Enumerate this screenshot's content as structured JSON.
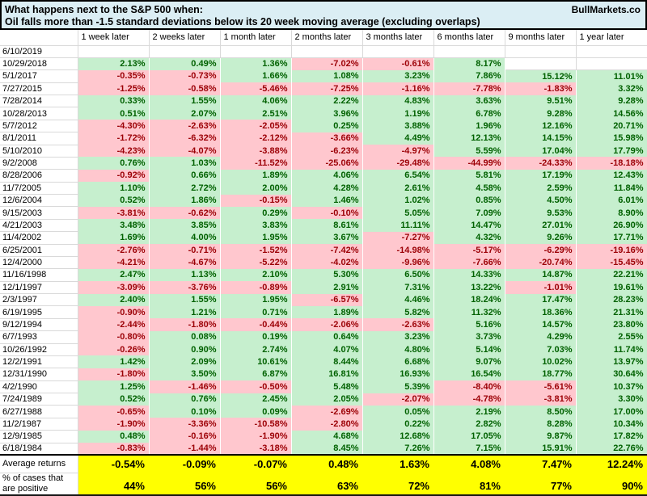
{
  "title": {
    "line1": "What happens next to the S&P 500 when:",
    "line2": "Oil falls more than -1.5 standard deviations below its 20 week moving average (excluding overlaps)",
    "brand": "BullMarkets.co"
  },
  "colors": {
    "title_bg": "#dbeef4",
    "positive_bg": "#c6efce",
    "positive_text": "#006100",
    "negative_bg": "#ffc7ce",
    "negative_text": "#9c0006",
    "highlight_bg": "#ffff00"
  },
  "chart_data": {
    "type": "table",
    "title": "What happens next to the S&P 500 when: Oil falls more than -1.5 standard deviations below its 20 week moving average (excluding overlaps)",
    "columns": [
      "1 week later",
      "2 weeks later",
      "1 month later",
      "2 months later",
      "3 months later",
      "6 months later",
      "9 months later",
      "1 year later"
    ],
    "rows": [
      {
        "date": "6/10/2019",
        "values": [
          null,
          null,
          null,
          null,
          null,
          null,
          null,
          null
        ]
      },
      {
        "date": "10/29/2018",
        "values": [
          "2.13%",
          "0.49%",
          "1.36%",
          "-7.02%",
          "-0.61%",
          "8.17%",
          null,
          null
        ]
      },
      {
        "date": "5/1/2017",
        "values": [
          "-0.35%",
          "-0.73%",
          "1.66%",
          "1.08%",
          "3.23%",
          "7.86%",
          "15.12%",
          "11.01%"
        ]
      },
      {
        "date": "7/27/2015",
        "values": [
          "-1.25%",
          "-0.58%",
          "-5.46%",
          "-7.25%",
          "-1.16%",
          "-7.78%",
          "-1.83%",
          "3.32%"
        ]
      },
      {
        "date": "7/28/2014",
        "values": [
          "0.33%",
          "1.55%",
          "4.06%",
          "2.22%",
          "4.83%",
          "3.63%",
          "9.51%",
          "9.28%"
        ]
      },
      {
        "date": "10/28/2013",
        "values": [
          "0.51%",
          "2.07%",
          "2.51%",
          "3.96%",
          "1.19%",
          "6.78%",
          "9.28%",
          "14.56%"
        ]
      },
      {
        "date": "5/7/2012",
        "values": [
          "-4.30%",
          "-2.63%",
          "-2.05%",
          "0.25%",
          "3.88%",
          "1.96%",
          "12.16%",
          "20.71%"
        ]
      },
      {
        "date": "8/1/2011",
        "values": [
          "-1.72%",
          "-6.32%",
          "-2.12%",
          "-3.66%",
          "4.49%",
          "12.13%",
          "14.15%",
          "15.98%"
        ]
      },
      {
        "date": "5/10/2010",
        "values": [
          "-4.23%",
          "-4.07%",
          "-3.88%",
          "-6.23%",
          "-4.97%",
          "5.59%",
          "17.04%",
          "17.79%"
        ]
      },
      {
        "date": "9/2/2008",
        "values": [
          "0.76%",
          "1.03%",
          "-11.52%",
          "-25.06%",
          "-29.48%",
          "-44.99%",
          "-24.33%",
          "-18.18%"
        ]
      },
      {
        "date": "8/28/2006",
        "values": [
          "-0.92%",
          "0.66%",
          "1.89%",
          "4.06%",
          "6.54%",
          "5.81%",
          "17.19%",
          "12.43%"
        ]
      },
      {
        "date": "11/7/2005",
        "values": [
          "1.10%",
          "2.72%",
          "2.00%",
          "4.28%",
          "2.61%",
          "4.58%",
          "2.59%",
          "11.84%"
        ]
      },
      {
        "date": "12/6/2004",
        "values": [
          "0.52%",
          "1.86%",
          "-0.15%",
          "1.46%",
          "1.02%",
          "0.85%",
          "4.50%",
          "6.01%"
        ]
      },
      {
        "date": "9/15/2003",
        "values": [
          "-3.81%",
          "-0.62%",
          "0.29%",
          "-0.10%",
          "5.05%",
          "7.09%",
          "9.53%",
          "8.90%"
        ]
      },
      {
        "date": "4/21/2003",
        "values": [
          "3.48%",
          "3.85%",
          "3.83%",
          "8.61%",
          "11.11%",
          "14.47%",
          "27.01%",
          "26.90%"
        ]
      },
      {
        "date": "11/4/2002",
        "values": [
          "1.69%",
          "4.00%",
          "1.95%",
          "3.67%",
          "-7.27%",
          "4.32%",
          "9.26%",
          "17.71%"
        ]
      },
      {
        "date": "6/25/2001",
        "values": [
          "-2.76%",
          "-0.71%",
          "-1.52%",
          "-7.42%",
          "-14.98%",
          "-5.17%",
          "-6.29%",
          "-19.16%"
        ]
      },
      {
        "date": "12/4/2000",
        "values": [
          "-4.21%",
          "-4.67%",
          "-5.22%",
          "-4.02%",
          "-9.96%",
          "-7.66%",
          "-20.74%",
          "-15.45%"
        ]
      },
      {
        "date": "11/16/1998",
        "values": [
          "2.47%",
          "1.13%",
          "2.10%",
          "5.30%",
          "6.50%",
          "14.33%",
          "14.87%",
          "22.21%"
        ]
      },
      {
        "date": "12/1/1997",
        "values": [
          "-3.09%",
          "-3.76%",
          "-0.89%",
          "2.91%",
          "7.31%",
          "13.22%",
          "-1.01%",
          "19.61%"
        ]
      },
      {
        "date": "2/3/1997",
        "values": [
          "2.40%",
          "1.55%",
          "1.95%",
          "-6.57%",
          "4.46%",
          "18.24%",
          "17.47%",
          "28.23%"
        ]
      },
      {
        "date": "6/19/1995",
        "values": [
          "-0.90%",
          "1.21%",
          "0.71%",
          "1.89%",
          "5.82%",
          "11.32%",
          "18.36%",
          "21.31%"
        ]
      },
      {
        "date": "9/12/1994",
        "values": [
          "-2.44%",
          "-1.80%",
          "-0.44%",
          "-2.06%",
          "-2.63%",
          "5.16%",
          "14.57%",
          "23.80%"
        ]
      },
      {
        "date": "6/7/1993",
        "values": [
          "-0.80%",
          "0.08%",
          "0.19%",
          "0.64%",
          "3.23%",
          "3.73%",
          "4.29%",
          "2.55%"
        ]
      },
      {
        "date": "10/26/1992",
        "values": [
          "-0.26%",
          "0.90%",
          "2.74%",
          "4.07%",
          "4.80%",
          "5.14%",
          "7.03%",
          "11.74%"
        ]
      },
      {
        "date": "12/2/1991",
        "values": [
          "1.42%",
          "2.09%",
          "10.61%",
          "8.44%",
          "6.68%",
          "9.07%",
          "10.02%",
          "13.97%"
        ]
      },
      {
        "date": "12/31/1990",
        "values": [
          "-1.80%",
          "3.50%",
          "6.87%",
          "16.81%",
          "16.93%",
          "16.54%",
          "18.77%",
          "30.64%"
        ]
      },
      {
        "date": "4/2/1990",
        "values": [
          "1.25%",
          "-1.46%",
          "-0.50%",
          "5.48%",
          "5.39%",
          "-8.40%",
          "-5.61%",
          "10.37%"
        ]
      },
      {
        "date": "7/24/1989",
        "values": [
          "0.52%",
          "0.76%",
          "2.45%",
          "2.05%",
          "-2.07%",
          "-4.78%",
          "-3.81%",
          "3.30%"
        ]
      },
      {
        "date": "6/27/1988",
        "values": [
          "-0.65%",
          "0.10%",
          "0.09%",
          "-2.69%",
          "0.05%",
          "2.19%",
          "8.50%",
          "17.00%"
        ]
      },
      {
        "date": "11/2/1987",
        "values": [
          "-1.90%",
          "-3.36%",
          "-10.58%",
          "-2.80%",
          "0.22%",
          "2.82%",
          "8.28%",
          "10.34%"
        ]
      },
      {
        "date": "12/9/1985",
        "values": [
          "0.48%",
          "-0.16%",
          "-1.90%",
          "4.68%",
          "12.68%",
          "17.05%",
          "9.87%",
          "17.82%"
        ]
      },
      {
        "date": "6/18/1984",
        "values": [
          "-0.83%",
          "-1.44%",
          "-3.18%",
          "8.45%",
          "7.26%",
          "7.15%",
          "15.91%",
          "22.76%"
        ]
      }
    ],
    "summary": {
      "average_label": "Average returns",
      "average_values": [
        "-0.54%",
        "-0.09%",
        "-0.07%",
        "0.48%",
        "1.63%",
        "4.08%",
        "7.47%",
        "12.24%"
      ],
      "percent_positive_label": "% of cases that are positive",
      "percent_positive_values": [
        "44%",
        "56%",
        "56%",
        "63%",
        "72%",
        "81%",
        "77%",
        "90%"
      ]
    },
    "layout": {
      "cell_color_rule": "green if positive, pink if negative, white if blank",
      "summary_row_highlight": "yellow"
    }
  }
}
